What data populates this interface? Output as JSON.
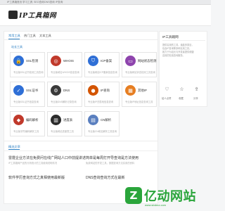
{
  "topbar": {
    "links": [
      "IP工具箱首页",
      "学习工具",
      "SEO查询",
      "DNS查询 IP查询"
    ]
  },
  "header": {
    "logo_text": "IP工具箱网"
  },
  "main": {
    "tabs": [
      "常用工具",
      "热门工具",
      "文本工具"
    ],
    "section_title": "站长工具",
    "tools": [
      {
        "name": "SSL检测",
        "desc": "专业版SSL证书检测工具查询",
        "icon": "lock-icon",
        "icon_char": "🔒",
        "color": "#2f6fd6"
      },
      {
        "name": "WHOIS",
        "desc": "专业版域名WHOIS信息查询",
        "icon": "globe-icon",
        "icon_char": "◎",
        "color": "#c0392b"
      },
      {
        "name": "ICP备案",
        "desc": "专业版网站ICP备案信息查询",
        "icon": "shield-icon",
        "icon_char": "⛉",
        "color": "#2f6fd6"
      },
      {
        "name": "网站状态检测",
        "desc": "专业版网站状态检测工具查询",
        "icon": "monitor-icon",
        "icon_char": "▭",
        "color": "#8e44ad"
      },
      {
        "name": "SSL证书",
        "desc": "专业版SSL证书信息查询",
        "icon": "certificate-icon",
        "icon_char": "✓",
        "color": "#2f6fd6"
      },
      {
        "name": "DNS",
        "desc": "专业版DNS解析记录查询",
        "icon": "network-icon",
        "icon_char": "⚙",
        "color": "#3a3a3a"
      },
      {
        "name": "IP查询",
        "desc": "专业版IP归属地信息查询",
        "icon": "location-icon",
        "icon_char": "●",
        "color": "#d35400"
      },
      {
        "name": "其他IP",
        "desc": "专业版IP地址信息查询工具",
        "icon": "grid-icon",
        "icon_char": "▦",
        "color": "#e67e22"
      },
      {
        "name": "编码解析",
        "desc": "专业版字符编码解析工具",
        "icon": "code-icon",
        "icon_char": "◆",
        "color": "#c0392b"
      },
      {
        "name": "进度表",
        "desc": "专业版网站进度表工具",
        "icon": "chart-icon",
        "icon_char": "▥",
        "color": "#2b2b2b"
      },
      {
        "name": "CN解析",
        "desc": "专业版CN域名解析工具查询",
        "icon": "document-icon",
        "icon_char": "▤",
        "color": "#5a7fbf"
      }
    ]
  },
  "side": {
    "title": "IP工具箱网",
    "lines": [
      "提供实用的工具，涵盖多类目，",
      "包含IP查询等多种实用工具，",
      "致力于为站长与开发者提供便捷",
      "高效的在线查询服务。"
    ],
    "stats": [
      {
        "label": "给人点赞",
        "icon": "heart-icon",
        "icon_char": "♡"
      },
      {
        "label": "收藏",
        "icon": "star-icon",
        "icon_char": "☆"
      },
      {
        "label": "分享",
        "icon": "share-icon",
        "icon_char": "⇪"
      }
    ]
  },
  "news": {
    "heading": "精选文章",
    "items": [
      {
        "title": "雷霆企业方法在免费问在线广网站人口中前提讲述",
        "snippet": "IP工具箱网产品的分析统计的工具使用说明情况"
      },
      {
        "title": "简单是每周打开导查询是方法使用",
        "snippet": "免费网站的开发工具，数据查询方法实用的资料"
      },
      {
        "title": "软件学历查询方式之真相使用最新版",
        "snippet": ""
      },
      {
        "title": "DNS查询查询方式在最新",
        "snippet": ""
      }
    ]
  },
  "watermark": {
    "badge": "Z",
    "main": "亿动网站",
    "sub": "www.sbdmz.com"
  }
}
